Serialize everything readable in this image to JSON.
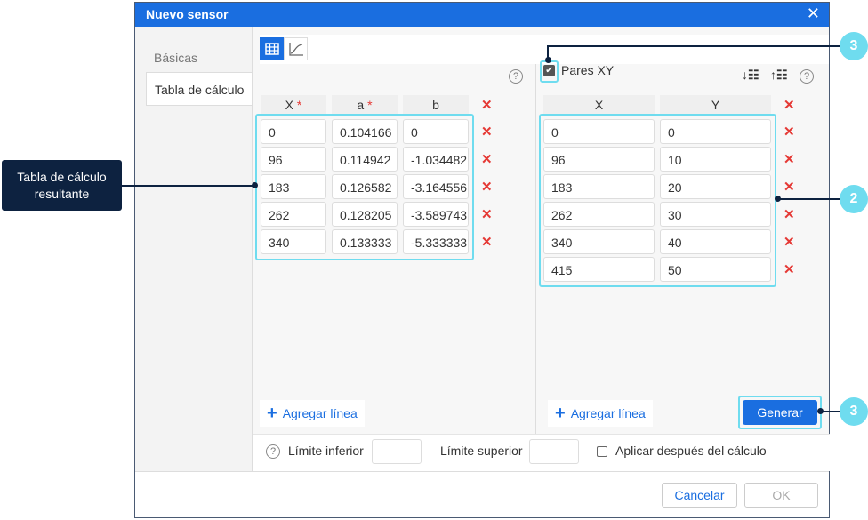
{
  "dialog": {
    "title": "Nuevo sensor"
  },
  "sidebar": {
    "tabs": [
      {
        "label": "Básicas"
      },
      {
        "label": "Tabla de cálculo"
      }
    ]
  },
  "left_table": {
    "headers": [
      "X",
      "a",
      "b"
    ],
    "required_mark": "*",
    "rows": [
      [
        "0",
        "0.104166",
        "0"
      ],
      [
        "96",
        "0.114942",
        "-1.034482"
      ],
      [
        "183",
        "0.126582",
        "-3.164556"
      ],
      [
        "262",
        "0.128205",
        "-3.589743"
      ],
      [
        "340",
        "0.133333",
        "-5.333333"
      ]
    ],
    "add_label": "Agregar línea"
  },
  "right_table": {
    "checkbox_label": "Pares XY",
    "checked": true,
    "headers": [
      "X",
      "Y"
    ],
    "rows": [
      [
        "0",
        "0"
      ],
      [
        "96",
        "10"
      ],
      [
        "183",
        "20"
      ],
      [
        "262",
        "30"
      ],
      [
        "340",
        "40"
      ],
      [
        "415",
        "50"
      ]
    ],
    "add_label": "Agregar línea",
    "generate_label": "Generar"
  },
  "bounds": {
    "lower_label": "Límite inferior",
    "lower_value": "",
    "upper_label": "Límite superior",
    "upper_value": "",
    "apply_label": "Aplicar después del cálculo"
  },
  "footer": {
    "cancel": "Cancelar",
    "ok": "OK"
  },
  "callouts": {
    "result_label": "Tabla de cálculo resultante",
    "n3a": "3",
    "n2": "2",
    "n3b": "3"
  },
  "colors": {
    "accent": "#1a6ee0",
    "highlight": "#6fdcef",
    "callout": "#0d2240",
    "delete": "#e53935"
  }
}
